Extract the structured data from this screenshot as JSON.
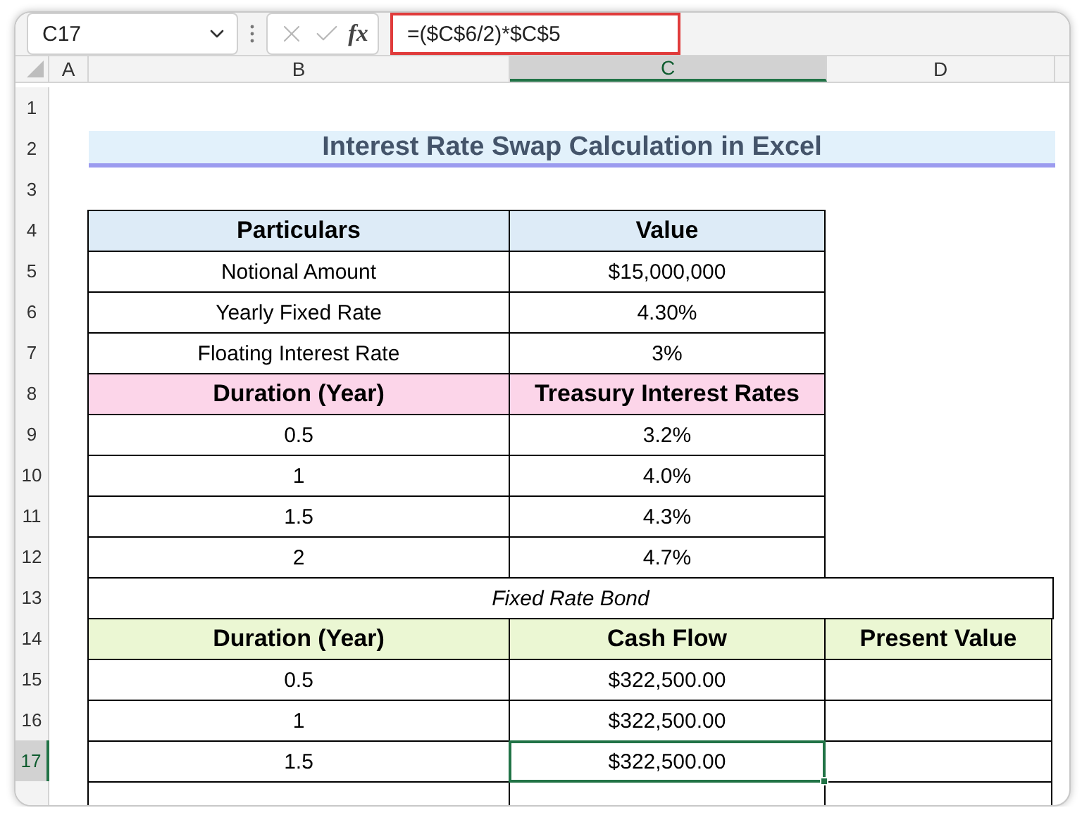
{
  "name_box": "C17",
  "function_label": "fx",
  "formula": "=($C$6/2)*$C$5",
  "columns": [
    {
      "label": "A",
      "selected": false
    },
    {
      "label": "B",
      "selected": false
    },
    {
      "label": "C",
      "selected": true
    },
    {
      "label": "D",
      "selected": false
    }
  ],
  "rows": [
    {
      "number": "1",
      "selected": false,
      "kind": "blank"
    },
    {
      "number": "2",
      "selected": false,
      "kind": "title",
      "text": "Interest Rate Swap Calculation in Excel"
    },
    {
      "number": "3",
      "selected": false,
      "kind": "blank"
    },
    {
      "number": "4",
      "selected": false,
      "kind": "header",
      "color": "#ddebf7",
      "cells": [
        {
          "text": "Particulars",
          "selected": false
        },
        {
          "text": "Value",
          "selected": false
        }
      ]
    },
    {
      "number": "5",
      "selected": false,
      "kind": "data",
      "cells": [
        {
          "text": "Notional Amount",
          "selected": false
        },
        {
          "text": "$15,000,000",
          "selected": false
        }
      ]
    },
    {
      "number": "6",
      "selected": false,
      "kind": "data",
      "cells": [
        {
          "text": "Yearly Fixed Rate",
          "selected": false
        },
        {
          "text": "4.30%",
          "selected": false
        }
      ]
    },
    {
      "number": "7",
      "selected": false,
      "kind": "data",
      "cells": [
        {
          "text": "Floating Interest Rate",
          "selected": false
        },
        {
          "text": "3%",
          "selected": false
        }
      ]
    },
    {
      "number": "8",
      "selected": false,
      "kind": "header",
      "color": "#fcd5e9",
      "cells": [
        {
          "text": "Duration (Year)",
          "selected": false
        },
        {
          "text": "Treasury Interest Rates",
          "selected": false
        }
      ]
    },
    {
      "number": "9",
      "selected": false,
      "kind": "data",
      "cells": [
        {
          "text": "0.5",
          "selected": false
        },
        {
          "text": "3.2%",
          "selected": false
        }
      ]
    },
    {
      "number": "10",
      "selected": false,
      "kind": "data",
      "cells": [
        {
          "text": "1",
          "selected": false
        },
        {
          "text": "4.0%",
          "selected": false
        }
      ]
    },
    {
      "number": "11",
      "selected": false,
      "kind": "data",
      "cells": [
        {
          "text": "1.5",
          "selected": false
        },
        {
          "text": "4.3%",
          "selected": false
        }
      ]
    },
    {
      "number": "12",
      "selected": false,
      "kind": "data",
      "cells": [
        {
          "text": "2",
          "selected": false
        },
        {
          "text": "4.7%",
          "selected": false
        }
      ]
    },
    {
      "number": "13",
      "selected": false,
      "kind": "caption",
      "text": "Fixed Rate Bond"
    },
    {
      "number": "14",
      "selected": false,
      "kind": "header",
      "color": "#ebf7d3",
      "cells": [
        {
          "text": "Duration (Year)",
          "selected": false
        },
        {
          "text": "Cash Flow",
          "selected": false
        },
        {
          "text": "Present Value",
          "selected": false
        }
      ]
    },
    {
      "number": "15",
      "selected": false,
      "kind": "data",
      "cells": [
        {
          "text": "0.5",
          "selected": false
        },
        {
          "text": "$322,500.00",
          "selected": false
        },
        {
          "selected": false
        }
      ]
    },
    {
      "number": "16",
      "selected": false,
      "kind": "data",
      "cells": [
        {
          "text": "1",
          "selected": false
        },
        {
          "text": "$322,500.00",
          "selected": false
        },
        {
          "selected": false
        }
      ]
    },
    {
      "number": "17",
      "selected": true,
      "kind": "data",
      "cells": [
        {
          "text": "1.5",
          "selected": false
        },
        {
          "text": "$322,500.00",
          "selected": true
        },
        {
          "selected": false
        }
      ]
    },
    {
      "selected": false,
      "kind": "data",
      "cells": [
        {
          "selected": false
        },
        {
          "selected": false
        },
        {
          "selected": false
        }
      ]
    }
  ]
}
